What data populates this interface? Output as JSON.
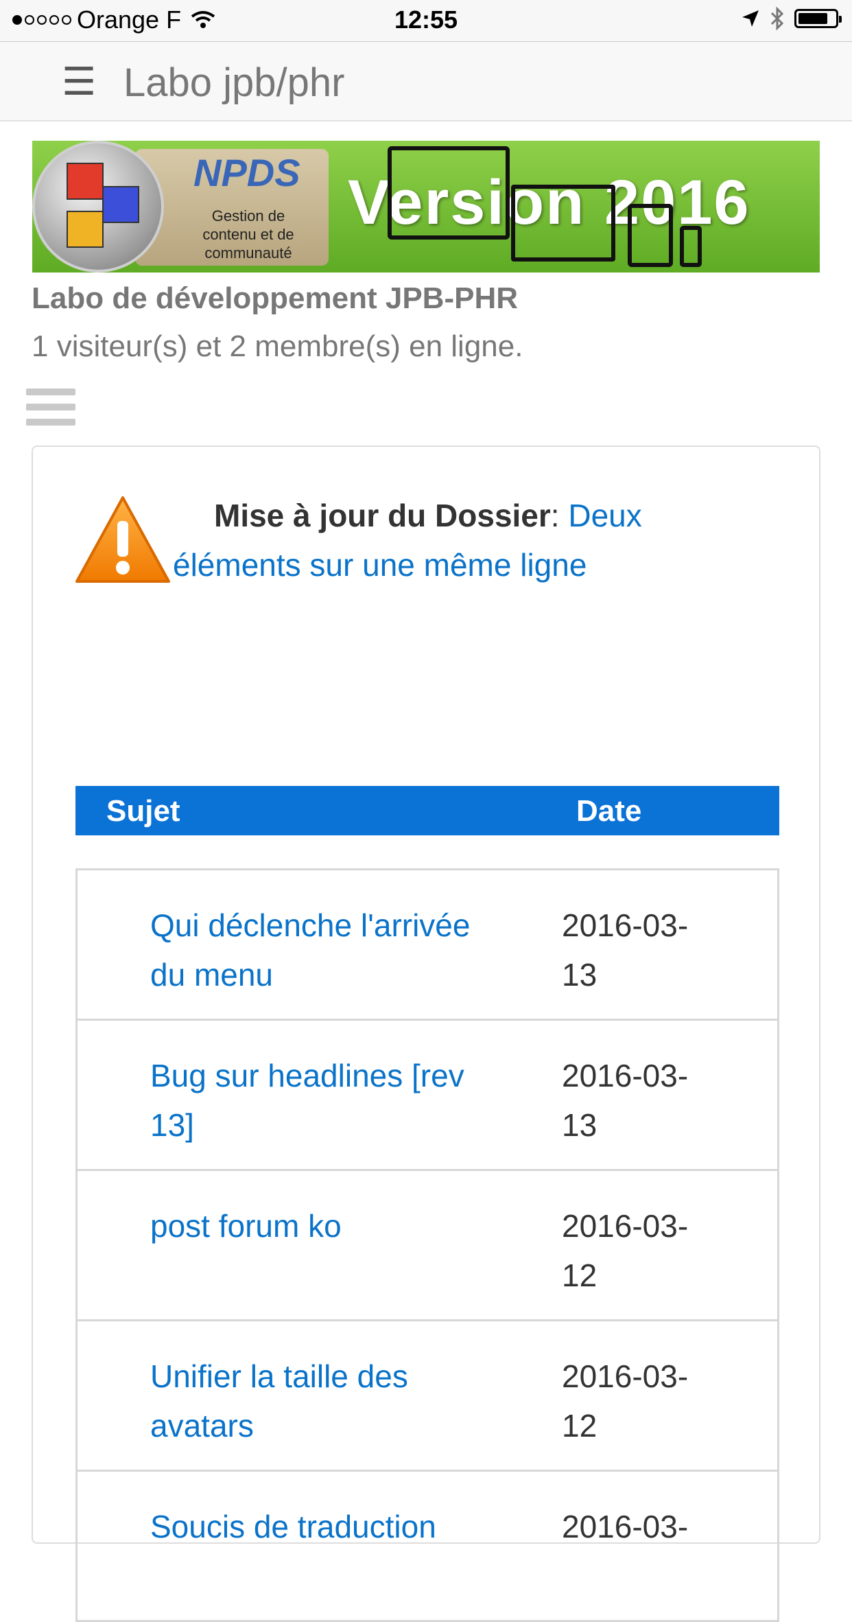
{
  "status_bar": {
    "carrier": "Orange F",
    "time": "12:55",
    "signal_level": "1/5",
    "battery_level": 0.8
  },
  "navbar": {
    "title": "Labo jpb/phr"
  },
  "banner": {
    "logo_text": "NPDS",
    "logo_subtitle": "Gestion de contenu et de communauté",
    "version_text": "Version 2016"
  },
  "site": {
    "title": "Labo de développement JPB-PHR",
    "online": "1 visiteur(s) et 2 membre(s) en ligne."
  },
  "notice": {
    "label": "Mise à jour du Dossier",
    "separator": ":",
    "link": "Deux éléments sur une même ligne"
  },
  "table": {
    "col_subject": "Sujet",
    "col_date": "Date",
    "rows": [
      {
        "subject": "Qui déclenche l'arrivée du menu",
        "date": "2016-03-13"
      },
      {
        "subject": "Bug sur headlines [rev 13]",
        "date": "2016-03-13"
      },
      {
        "subject": "post forum ko",
        "date": "2016-03-12"
      },
      {
        "subject": "Unifier la taille des avatars",
        "date": "2016-03-12"
      },
      {
        "subject": "Soucis de traduction",
        "date": "2016-03-"
      }
    ]
  }
}
